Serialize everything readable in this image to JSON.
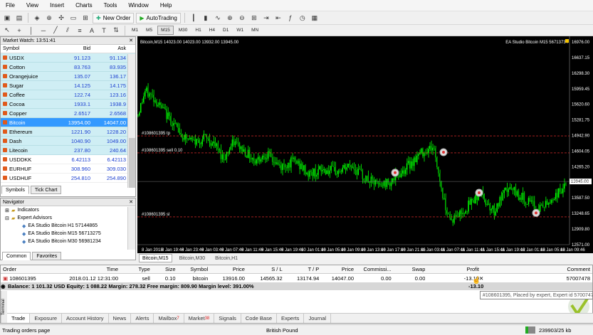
{
  "menu": [
    "File",
    "View",
    "Insert",
    "Charts",
    "Tools",
    "Window",
    "Help"
  ],
  "toolbar": {
    "new_order": "New Order",
    "autotrading": "AutoTrading",
    "timeframes": [
      "M1",
      "M5",
      "M15",
      "M30",
      "H1",
      "H4",
      "D1",
      "W1",
      "MN"
    ],
    "active_tf": "M15"
  },
  "market_watch": {
    "title": "Market Watch: 13:51:41",
    "headers": [
      "Symbol",
      "Bid",
      "Ask"
    ],
    "rows": [
      {
        "symbol": "USDX",
        "bid": "91.123",
        "ask": "91.134"
      },
      {
        "symbol": "Cotton",
        "bid": "83.763",
        "ask": "83.935"
      },
      {
        "symbol": "Orangejuice",
        "bid": "135.07",
        "ask": "136.17"
      },
      {
        "symbol": "Sugar",
        "bid": "14.125",
        "ask": "14.175"
      },
      {
        "symbol": "Coffee",
        "bid": "122.74",
        "ask": "123.16"
      },
      {
        "symbol": "Cocoa",
        "bid": "1933.1",
        "ask": "1938.9"
      },
      {
        "symbol": "Copper",
        "bid": "2.6517",
        "ask": "2.6568"
      },
      {
        "symbol": "Bitcoin",
        "bid": "13954.00",
        "ask": "14047.00",
        "selected": true
      },
      {
        "symbol": "Ethereum",
        "bid": "1221.90",
        "ask": "1228.20"
      },
      {
        "symbol": "Dash",
        "bid": "1040.90",
        "ask": "1049.00"
      },
      {
        "symbol": "Litecoin",
        "bid": "237.80",
        "ask": "240.64"
      },
      {
        "symbol": "USDDKK",
        "bid": "6.42113",
        "ask": "6.42113",
        "white": true
      },
      {
        "symbol": "EURHUF",
        "bid": "308.960",
        "ask": "309.030",
        "white": true
      },
      {
        "symbol": "USDHUF",
        "bid": "254.810",
        "ask": "254.890",
        "white": true
      }
    ],
    "tabs": [
      "Symbols",
      "Tick Chart"
    ]
  },
  "navigator": {
    "title": "Navigator",
    "items": [
      "Indicators",
      "Expert Advisors",
      "EA Studio Bitcoin H1 57144865",
      "EA Studio Bitcoin M15 56713275",
      "EA Studio Bitcoin M30 56981234"
    ],
    "tabs": [
      "Common",
      "Favorites"
    ]
  },
  "chart": {
    "header": "Bitcoin,M15  14023.00 14023.00 13932.00 13945.00",
    "ea_label": "EA Studio Bitcoin M15 56713734",
    "price_labels": [
      "16976.00",
      "16637.15",
      "16298.30",
      "15959.45",
      "15620.60",
      "15281.75",
      "14942.90",
      "14604.05",
      "14265.20",
      "13926.35",
      "13587.50",
      "13248.65",
      "12909.80",
      "12571.00"
    ],
    "current_price": "13945.00",
    "order_lines": [
      {
        "label": "#108601395 tp",
        "price": 14935
      },
      {
        "label": "#108601395 sell 0.10",
        "price": 14566
      },
      {
        "label": "#108601395 sl",
        "price": 13175
      }
    ],
    "time_labels": [
      "8 Jan 2018",
      "8 Jan 17:46",
      "8 Jan 19:46",
      "8 Jan 21:46",
      "8 Jan 23:46",
      "9 Jan 01:46",
      "9 Jan 03:46",
      "9 Jan 05:46",
      "9 Jan 07:46",
      "9 Jan 09:46",
      "9 Jan 11:46",
      "9 Jan 13:46",
      "9 Jan 15:46",
      "9 Jan 17:46",
      "9 Jan 19:46",
      "9 Jan 21:46",
      "10 Jan 01:46",
      "10 Jan 03:46",
      "10 Jan 05:46",
      "10 Jan 07:46",
      "10 Jan 09:46",
      "10 Jan 11:46",
      "10 Jan 13:46",
      "10 Jan 15:46",
      "10 Jan 17:46",
      "10 Jan 19:46",
      "10 Jan 21:46",
      "11 Jan 01:46",
      "11 Jan 03:46",
      "11 Jan 05:46",
      "11 Jan 07:46",
      "11 Jan 09:46",
      "11 Jan 11:46",
      "11 Jan 13:46",
      "11 Jan 15:46",
      "11 Jan 17:46",
      "11 Jan 19:46",
      "11 Jan 21:46",
      "12 Jan 01:46",
      "12 Jan 03:46",
      "12 Jan 05:46",
      "12 Jan 07:46",
      "12 Jan 09:46"
    ],
    "tabs": [
      "Bitcoin,M15",
      "Bitcoin,M30",
      "Bitcoin,H1"
    ]
  },
  "terminal": {
    "headers": [
      "Order",
      "/",
      "Time",
      "Type",
      "Size",
      "Symbol",
      "Price",
      "S / L",
      "T / P",
      "Price",
      "Commissi...",
      "Swap",
      "Profit",
      "Comment"
    ],
    "row": {
      "order": "108601395",
      "time": "2018.01.12 12:31:00",
      "type": "sell",
      "size": "0.10",
      "symbol": "bitcoin",
      "price": "13916.00",
      "sl": "14565.32",
      "tp": "13174.94",
      "cur": "14047.00",
      "comm": "0.00",
      "swap": "0.00",
      "profit": "-13.10",
      "comment": "57007478"
    },
    "balance": "Balance: 1 101.32 USD  Equity: 1 088.22  Margin: 278.32  Free margin: 809.90  Margin level: 391.00%",
    "total": "-13.10",
    "tooltip": "#108601395, Placed by expert, Expert id 5700747",
    "tabs": [
      "Trade",
      "Exposure",
      "Account History",
      "News",
      "Alerts",
      "Mailbox",
      "Market",
      "Signals",
      "Code Base",
      "Experts",
      "Journal"
    ],
    "mailbox_badge": "7",
    "market_badge": "38",
    "side_label": "Terminal"
  },
  "status": {
    "left": "Trading orders page",
    "center": "British Pound",
    "right": "239903/25 kb"
  },
  "colors": {
    "bull": "#00ff00",
    "bear": "#00c000",
    "order": "#ff3333",
    "select": "#3399ff"
  }
}
